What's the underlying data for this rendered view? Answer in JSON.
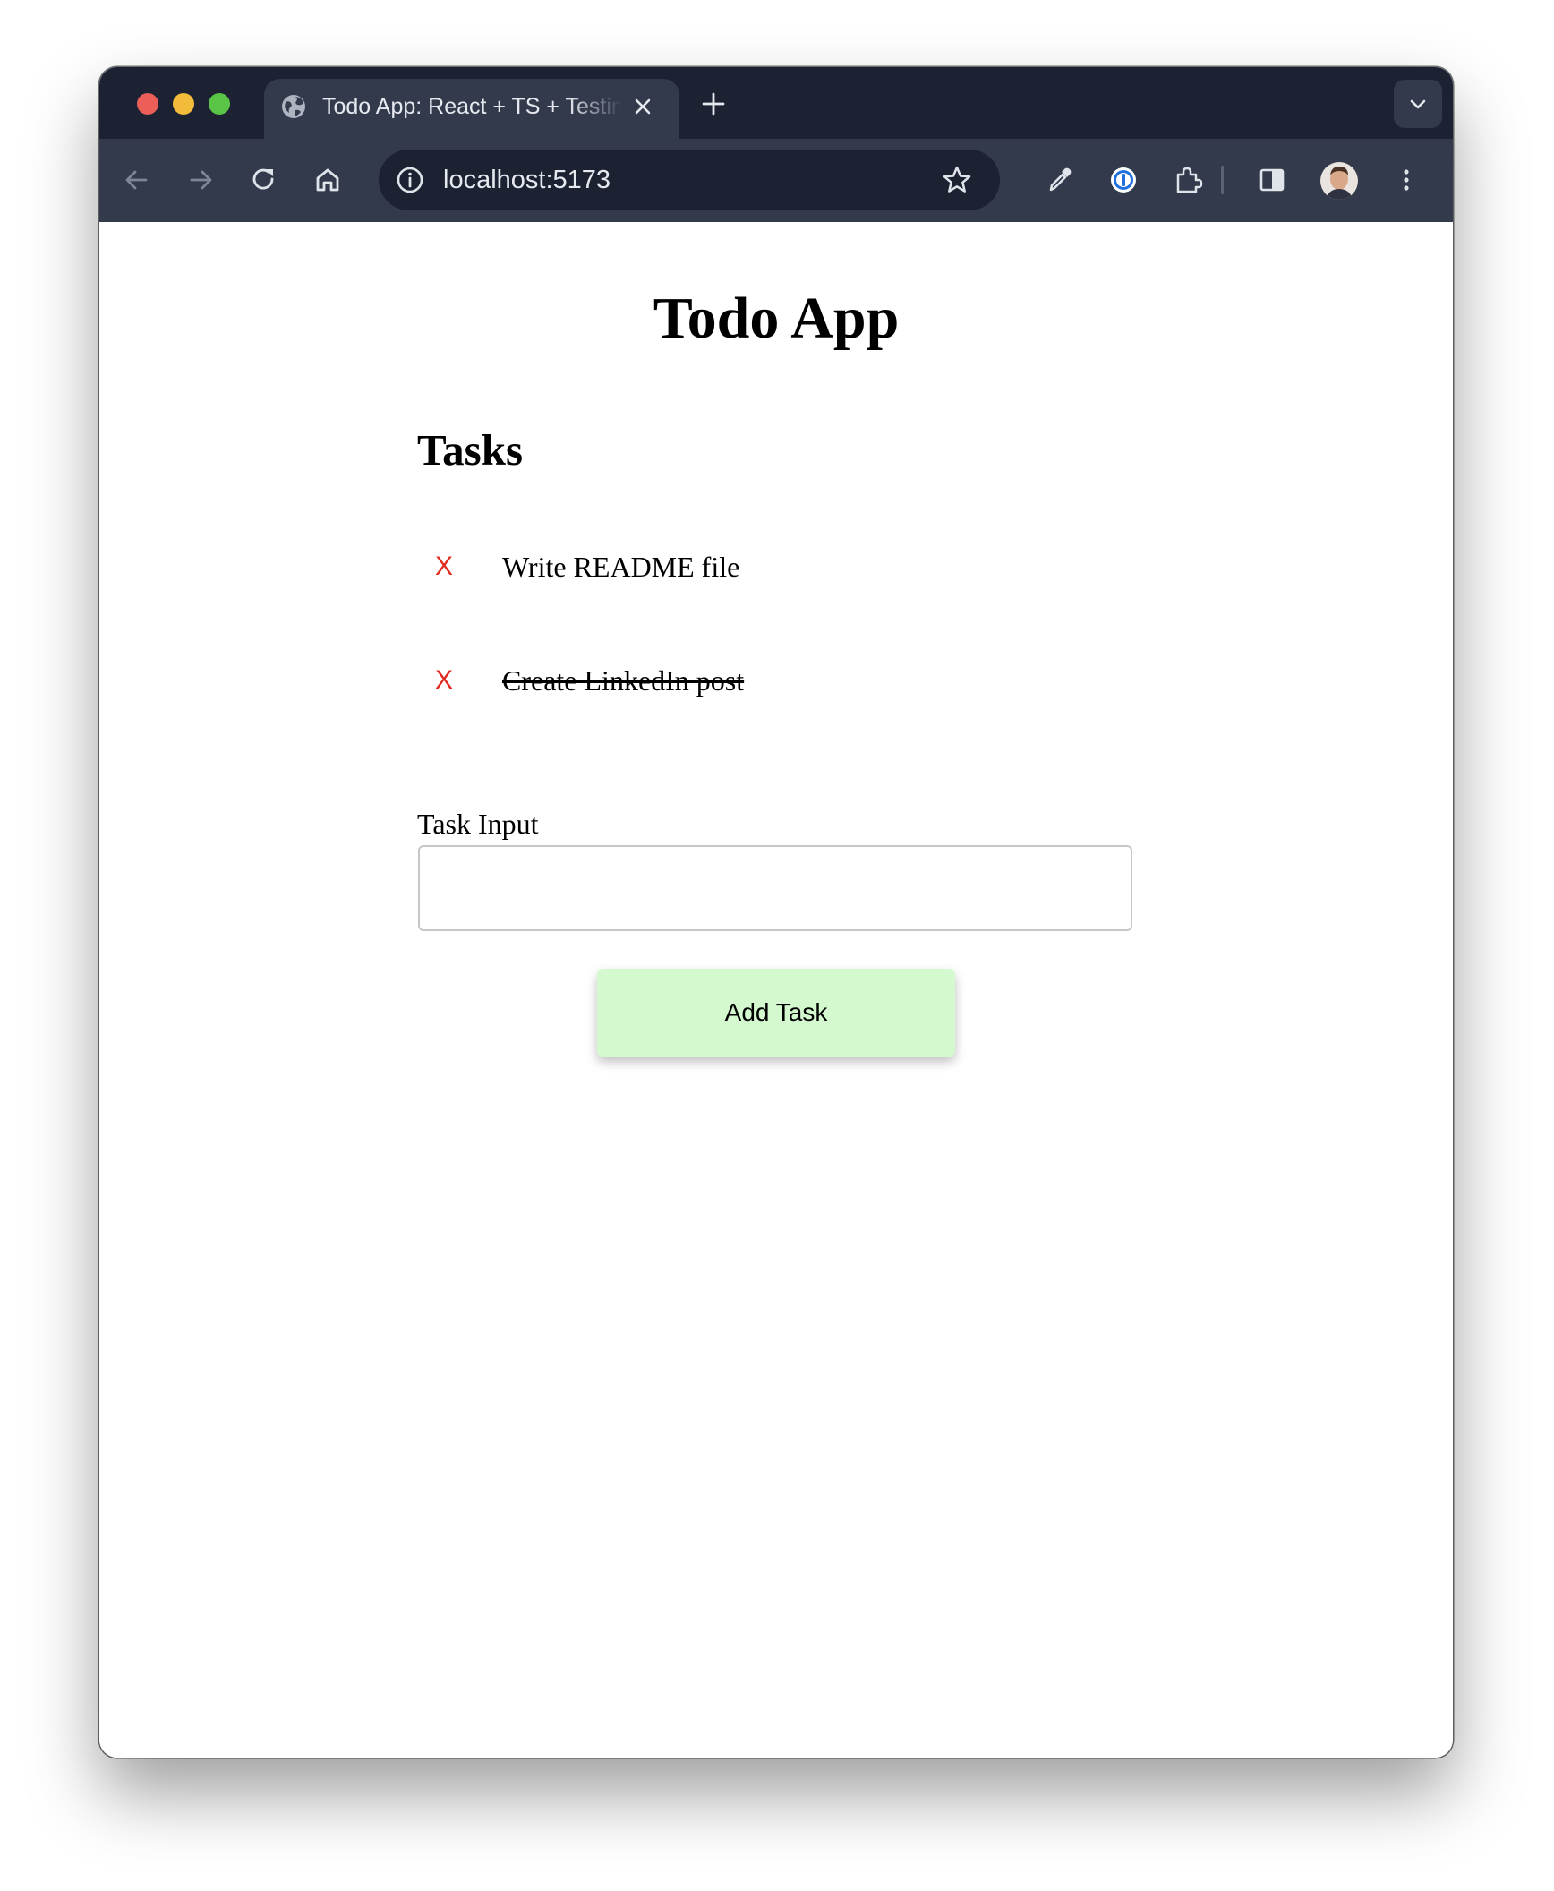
{
  "browser": {
    "tab": {
      "title": "Todo App: React + TS + Testing"
    },
    "url": "localhost:5173",
    "colors": {
      "tabstrip": "#1c2231",
      "toolbar": "#323a4b"
    }
  },
  "page": {
    "title": "Todo App",
    "tasks_heading": "Tasks",
    "tasks": [
      {
        "delete_label": "X",
        "text": "Write README file",
        "completed": false
      },
      {
        "delete_label": "X",
        "text": "Create LinkedIn post",
        "completed": true
      }
    ],
    "input_label": "Task Input",
    "input_value": "",
    "add_button_label": "Add Task",
    "colors": {
      "delete": "#e02b1f",
      "add_button_bg": "#d4f9cf"
    }
  }
}
